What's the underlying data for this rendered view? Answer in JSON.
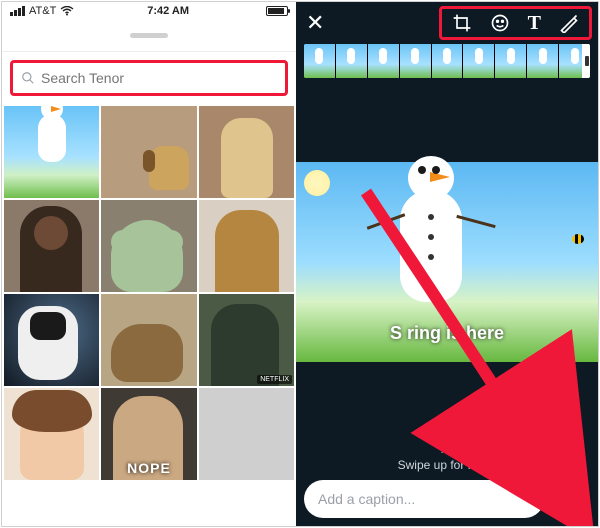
{
  "status": {
    "carrier": "AT&T",
    "time": "7:42 AM"
  },
  "search": {
    "placeholder": "Search Tenor"
  },
  "grid_labels": {
    "nope": "NOPE",
    "netflix": "NETFLIX"
  },
  "editor": {
    "overlay_text": "S ring is here",
    "swipe_hint": "Swipe up for filters",
    "caption_placeholder": "Add a caption..."
  },
  "icons": {
    "filmstrip_frames": 9
  }
}
